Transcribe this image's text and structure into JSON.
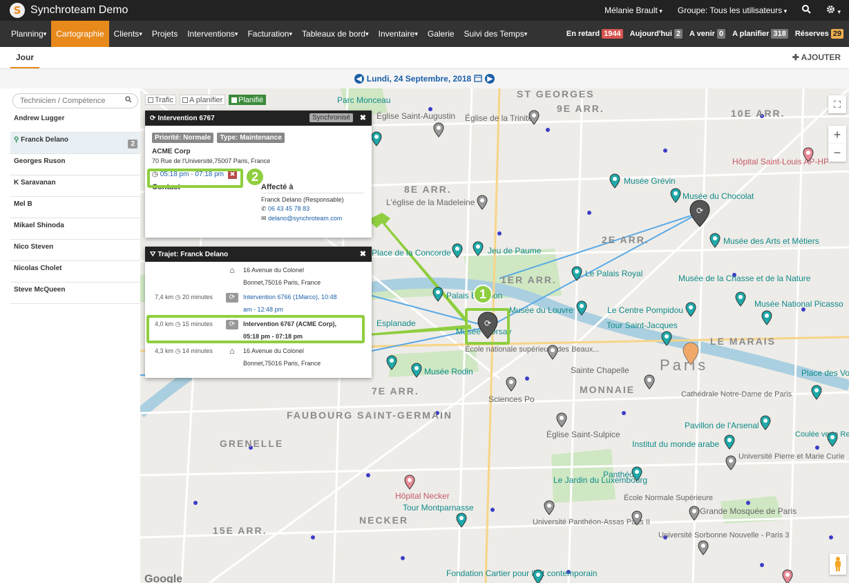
{
  "app": {
    "logo_letter": "S",
    "title": "Synchroteam Demo"
  },
  "topbar": {
    "user": "Mélanie Brault",
    "group": "Groupe: Tous les utilisateurs",
    "search_icon": "search-icon",
    "settings_icon": "gear-icon"
  },
  "nav": {
    "items": [
      {
        "label": "Planning",
        "dropdown": true
      },
      {
        "label": "Cartographie",
        "dropdown": false,
        "active": true
      },
      {
        "label": "Clients",
        "dropdown": true
      },
      {
        "label": "Projets",
        "dropdown": false
      },
      {
        "label": "Interventions",
        "dropdown": true
      },
      {
        "label": "Facturation",
        "dropdown": true
      },
      {
        "label": "Tableaux de bord",
        "dropdown": true
      },
      {
        "label": "Inventaire",
        "dropdown": true
      },
      {
        "label": "Galerie",
        "dropdown": false
      },
      {
        "label": "Suivi des Temps",
        "dropdown": true
      }
    ],
    "stats": [
      {
        "label": "En retard",
        "value": "1944",
        "color": "red"
      },
      {
        "label": "Aujourd'hui",
        "value": "2",
        "color": "gray"
      },
      {
        "label": "A venir",
        "value": "0",
        "color": "gray"
      },
      {
        "label": "A planifier",
        "value": "318",
        "color": "gray"
      },
      {
        "label": "Réserves",
        "value": "29",
        "color": "orange"
      }
    ]
  },
  "tabs": {
    "active": "Jour",
    "add_label": "AJOUTER"
  },
  "date": {
    "label": "Lundi, 24 Septembre, 2018"
  },
  "sidebar": {
    "search_placeholder": "Technicien / Compétence",
    "technicians": [
      {
        "name": "Andrew Lugger",
        "count": ""
      },
      {
        "name": "Franck Delano",
        "count": "2",
        "selected": true
      },
      {
        "name": "Georges Ruson",
        "count": ""
      },
      {
        "name": "K Saravanan",
        "count": ""
      },
      {
        "name": "Mel B",
        "count": ""
      },
      {
        "name": "Mikael Shinoda",
        "count": ""
      },
      {
        "name": "Nico Steven",
        "count": ""
      },
      {
        "name": "Nicolas Cholet",
        "count": ""
      },
      {
        "name": "Steve McQueen",
        "count": ""
      }
    ]
  },
  "map": {
    "filters": [
      {
        "label": "Trafic",
        "checked": false
      },
      {
        "label": "A planifier",
        "checked": false
      },
      {
        "label": "Planifié",
        "checked": true
      }
    ],
    "arrondissements": [
      "ST GEORGES",
      "9E ARR.",
      "10E ARR.",
      "8E ARR.",
      "2E ARR.",
      "1ER ARR.",
      "LE MARAIS",
      "7E ARR.",
      "MONNAIE",
      "FAUBOURG SAINT-GERMAIN",
      "GRENELLE",
      "NECKER",
      "15E ARR."
    ],
    "pois": [
      "Parc Monceau",
      "Église Saint-Augustin",
      "Église de la Trinité",
      "Hôpital Saint-Louis AP-HP",
      "Musée Grévin",
      "Musée du Chocolat",
      "L'église de la Madeleine",
      "Musée des Arts et Métiers",
      "Jeu de Paume",
      "Place de la Concorde",
      "Le Palais Royal",
      "Musée de la Chasse et de la Nature",
      "Palais Bourbon",
      "Musée du Louvre",
      "Le Centre Pompidou",
      "Musée National Picasso",
      "Tour Saint-Jacques",
      "Esplanade",
      "Musée d'Orsay",
      "École nationale supérieure des Beaux...",
      "Paris",
      "Musée Rodin",
      "Sainte Chapelle",
      "Place des Vosges",
      "Sciences Po",
      "Cathédrale Notre-Dame de Paris",
      "Église Saint-Sulpice",
      "Pavillon de l'Arsenal",
      "Institut du monde arabe",
      "Coulée verte René-Dumont",
      "Université Pierre et Marie Curie",
      "Le Jardin du Luxembourg",
      "Panthéon",
      "Hôpital Necker",
      "Tour Montparnasse",
      "École Normale Supérieure",
      "Grande Mosquée de Paris",
      "Université Panthéon-Assas Paris II",
      "Université Sorbonne Nouvelle - Paris 3",
      "Fondation Cartier pour l'art contemporain",
      "Google"
    ]
  },
  "intervention_popup": {
    "title": "Intervention 6767",
    "status": "Synchronisé",
    "priority": "Priorité: Normale",
    "type": "Type: Maintenance",
    "client": "ACME Corp",
    "address": "70 Rue de l'Université,75007 Paris, France",
    "time": "05:18 pm - 07:18 pm",
    "contact_label": "Contact",
    "assigned_label": "Affecté à",
    "assignee": "Franck Delano (Responsable)",
    "phone": "06 43 45 78 83",
    "email": "delano@synchroteam.com"
  },
  "trip_popup": {
    "title": "Trajet: Franck Delano",
    "rows": [
      {
        "dist": "",
        "dur": "",
        "icon": "home-icon",
        "text1": "16 Avenue du Colonel",
        "text2": "Bonnet,75016 Paris, France",
        "link": false
      },
      {
        "dist": "7,4 km",
        "dur": "20 minutes",
        "icon": "refresh-icon",
        "text1": "Intervention 6766 (1Marco), 10:48",
        "text2": "am - 12:48 pm",
        "link": true
      },
      {
        "dist": "4,0 km",
        "dur": "15 minutes",
        "icon": "refresh-icon",
        "text1": "Intervention 6767 (ACME Corp),",
        "text2": "05:18 pm - 07:18 pm",
        "link": false,
        "bold": true
      },
      {
        "dist": "4,3 km",
        "dur": "14 minutes",
        "icon": "home-icon",
        "text1": "16 Avenue du Colonel",
        "text2": "Bonnet,75016 Paris, France",
        "link": false
      }
    ]
  },
  "callouts": {
    "one": "1",
    "two": "2"
  },
  "colors": {
    "accent": "#e8891b",
    "highlight": "#8fce3f",
    "route": "#5aa9e6",
    "teal_marker": "#1fa9a9"
  }
}
